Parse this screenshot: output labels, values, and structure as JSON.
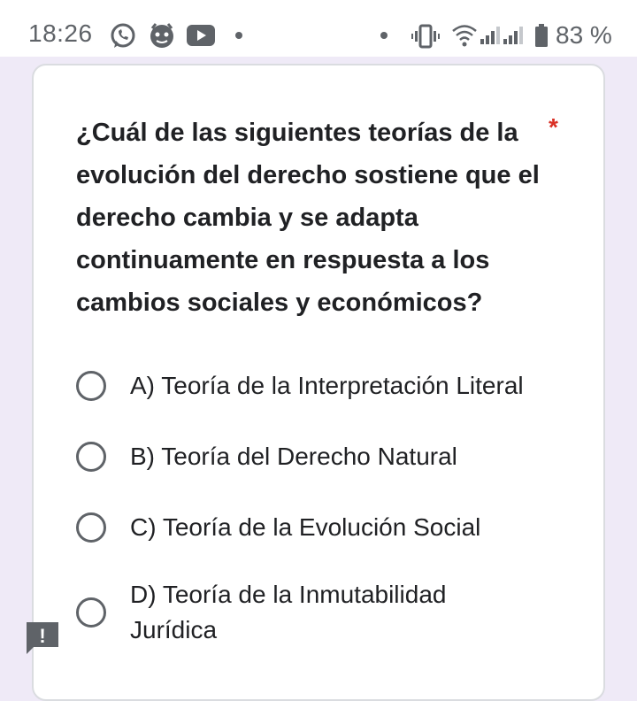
{
  "status_bar": {
    "time": "18:26",
    "battery_percent": "83 %",
    "icons": [
      "whatsapp-icon",
      "app-icon",
      "youtube-icon",
      "dot-icon",
      "dot-icon",
      "vibrate-icon",
      "wifi-icon",
      "signal-icon",
      "signal-icon",
      "battery-icon"
    ]
  },
  "question": {
    "text": "¿Cuál de las siguientes teorías de la evolución del derecho sostiene que el derecho cambia y se adapta continuamente en respuesta a los cambios sociales y económicos?",
    "required_mark": "*"
  },
  "options": [
    {
      "label": "A) Teoría de la Interpretación Literal"
    },
    {
      "label": "B) Teoría del Derecho Natural"
    },
    {
      "label": "C) Teoría de la Evolución Social"
    },
    {
      "label": "D) Teoría de la Inmutabilidad Jurídica"
    }
  ],
  "report_button": {
    "icon": "report-icon",
    "glyph": "!"
  },
  "colors": {
    "page_background": "#efeaf7",
    "card_background": "#ffffff",
    "required": "#d93025",
    "text": "#202124",
    "icon": "#5f6368"
  }
}
